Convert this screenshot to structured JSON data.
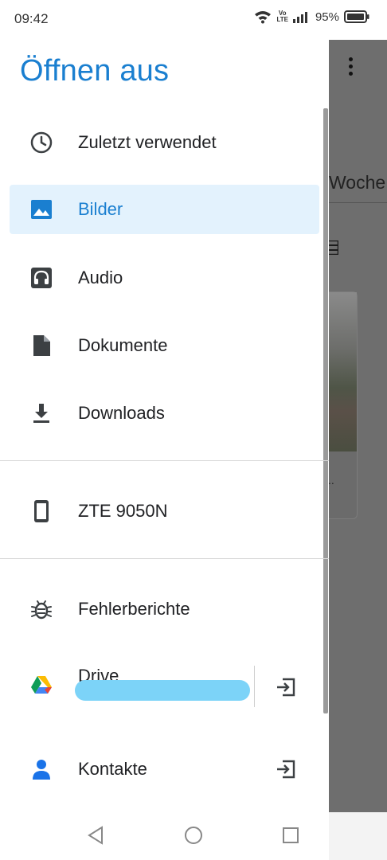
{
  "status_bar": {
    "time": "09:42",
    "volte_top": "Vo",
    "volte_bottom": "LTE",
    "battery": "95%"
  },
  "drawer": {
    "title": "Öffnen aus",
    "items": [
      {
        "label": "Zuletzt verwendet",
        "icon": "clock-icon",
        "selected": false
      },
      {
        "label": "Bilder",
        "icon": "image-icon",
        "selected": true
      },
      {
        "label": "Audio",
        "icon": "headphones-icon",
        "selected": false
      },
      {
        "label": "Dokumente",
        "icon": "document-icon",
        "selected": false
      },
      {
        "label": "Downloads",
        "icon": "download-icon",
        "selected": false
      }
    ],
    "devices": [
      {
        "label": "ZTE 9050N",
        "icon": "phone-icon"
      }
    ],
    "apps": [
      {
        "label": "Fehlerberichte",
        "icon": "bug-icon"
      },
      {
        "label": "Drive",
        "icon": "google-drive-icon",
        "has_eject": true
      },
      {
        "label": "Kontakte",
        "icon": "contacts-icon",
        "has_eject": true
      }
    ]
  },
  "background_app": {
    "tab_label": "Woche",
    "caption": ".."
  },
  "colors": {
    "accent": "#1a7fd0",
    "selected_bg": "#e3f2fd",
    "scrim": "#6e6e6e",
    "redaction": "#7cd3f8"
  }
}
